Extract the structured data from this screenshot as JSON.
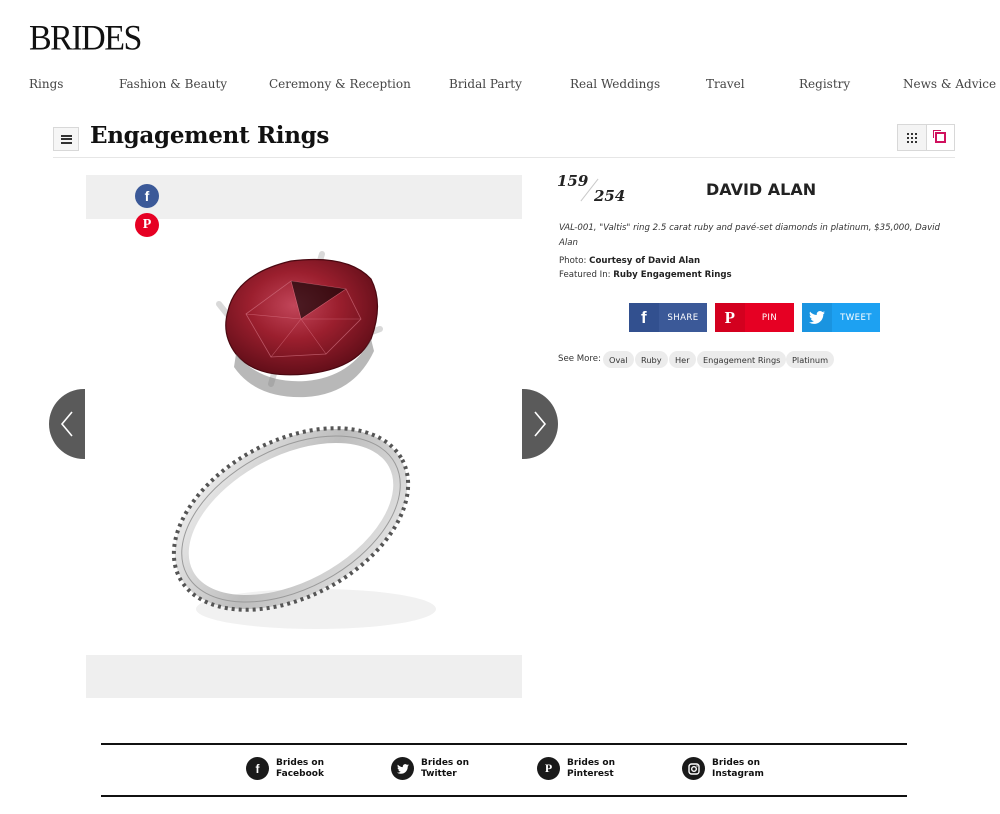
{
  "site": {
    "logo": "BRIDES"
  },
  "nav": [
    "Rings",
    "Fashion & Beauty",
    "Ceremony & Reception",
    "Bridal Party",
    "Real Weddings",
    "Travel",
    "Registry",
    "News & Advice"
  ],
  "gallery": {
    "title": "Engagement Rings",
    "current_slide": "159",
    "total_slides": "254",
    "view_modes": [
      "grid-icon",
      "single-icon"
    ],
    "active_view": "single"
  },
  "slide": {
    "designer": "DAVID ALAN",
    "caption": "VAL-001, \"Valtis\" ring 2.5 carat ruby and pavé-set diamonds in platinum, $35,000, David Alan",
    "photo_label": "Photo:",
    "photo_credit": "Courtesy of David Alan",
    "featured_label": "Featured In:",
    "featured_in": "Ruby Engagement Rings",
    "image_icons": [
      "facebook-icon",
      "pinterest-icon"
    ]
  },
  "share_buttons": {
    "facebook": "SHARE",
    "pinterest": "PIN",
    "twitter": "TWEET"
  },
  "see_more": {
    "label": "See More:",
    "tags": [
      "Oval",
      "Ruby",
      "Her",
      "Engagement Rings",
      "Platinum"
    ]
  },
  "footer": {
    "follow": [
      {
        "line1": "Brides on",
        "line2": "Facebook",
        "icon": "facebook-icon"
      },
      {
        "line1": "Brides on",
        "line2": "Twitter",
        "icon": "twitter-icon"
      },
      {
        "line1": "Brides on",
        "line2": "Pinterest",
        "icon": "pinterest-icon"
      },
      {
        "line1": "Brides on",
        "line2": "Instagram",
        "icon": "instagram-icon"
      }
    ]
  },
  "colors": {
    "facebook": "#3b5998",
    "pinterest": "#e60023",
    "twitter": "#1da1f2",
    "accent": "#d0115e",
    "ruby": "#8e1a26"
  }
}
